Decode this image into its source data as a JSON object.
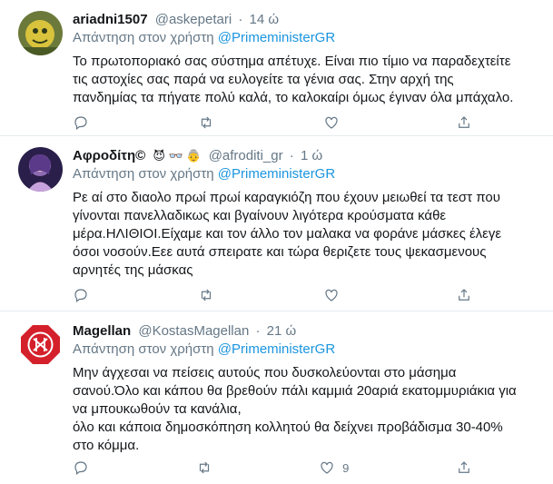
{
  "reply_prefix": "Απάντηση στον χρήστη",
  "mention": "@PrimeministerGR",
  "tweets": [
    {
      "name": "ariadni1507",
      "handle": "@askepetari",
      "time": "14 ώ",
      "lines": [
        "Το πρωτοποριακό σας σύστημα απέτυχε. Είναι πιο τίμιο να παραδεχτείτε",
        "τις αστοχίες σας παρά να ευλογείτε τα γένια σας. Στην αρχή της",
        "πανδημίας τα πήγατε πολύ καλά, το καλοκαίρι όμως έγιναν όλα μπάχαλο."
      ],
      "likes": ""
    },
    {
      "name": "Αφροδίτη©",
      "name_emojis": "😈 👓 👵",
      "handle": "@afroditi_gr",
      "time": "1 ώ",
      "lines": [
        "Ρε αί στο διαολο πρωί πρωί καραγκιόζη που έχουν μειωθεί τα τεστ που",
        "γίνονται πανελλαδικως και βγαίνουν λιγότερα κρούσματα κάθε",
        "μέρα.ΗΛΙΘΙΟΙ.Είχαμε και τον άλλο τον μαλακα να φοράνε μάσκες έλεγε",
        "όσοι νοσούν.Εεε αυτά σπειρατε και τώρα θεριζετε τους ψεκασμενους",
        "αρνητές της μάσκας"
      ],
      "likes": ""
    },
    {
      "name": "Magellan",
      "handle": "@KostasMagellan",
      "time": "21 ώ",
      "lines": [
        "Μην άγχεσαι να πείσεις αυτούς που δυσκολεύονται στο μάσημα",
        "σανού.Όλο και κάπου θα βρεθούν πάλι καμμιά 20αριά εκατομμυριάκια για",
        "να μπουκωθούν τα κανάλια,",
        "όλο και κάποια δημοσκόπηση κολλητού θα δείχνει προβάδισμα 30-40%",
        "στο κόμμα."
      ],
      "likes": "9"
    }
  ]
}
